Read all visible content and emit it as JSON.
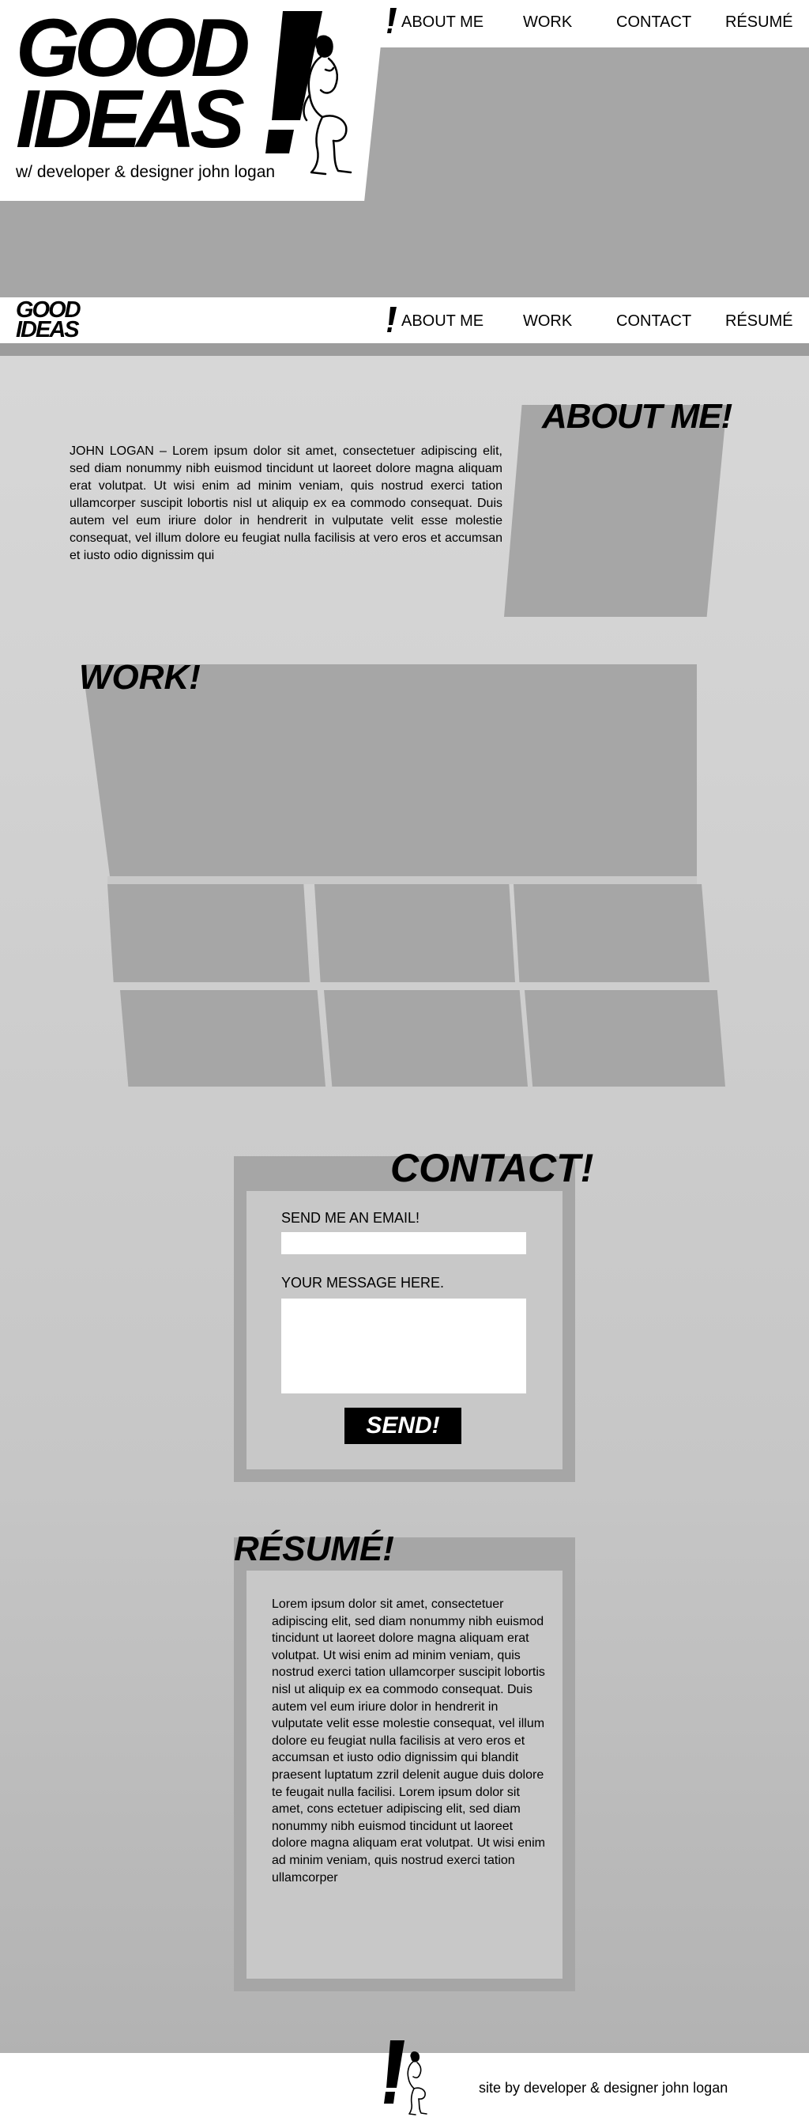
{
  "brand": {
    "logo_line1": "GOOD",
    "logo_line2": "IDEAS",
    "tagline": "w/ developer & designer john logan"
  },
  "nav": {
    "items": [
      "ABOUT ME",
      "WORK",
      "CONTACT",
      "RÉSUMÉ"
    ]
  },
  "about": {
    "heading": "ABOUT ME!",
    "body": "JOHN LOGAN – Lorem ipsum dolor sit amet, consectetuer adipiscing elit, sed diam nonummy nibh euismod tincidunt ut laoreet dolore magna aliquam erat volutpat. Ut wisi enim ad minim veniam, quis nostrud exerci tation ullamcorper suscipit lobortis nisl ut aliquip ex ea commodo consequat. Duis autem vel eum iriure dolor in hendrerit in vulputate velit esse molestie consequat, vel illum dolore eu feugiat nulla facilisis at vero eros et accumsan et iusto odio dignissim qui"
  },
  "work": {
    "heading": "WORK!"
  },
  "contact": {
    "heading": "CONTACT!",
    "email_label": "SEND ME AN EMAIL!",
    "email_value": "",
    "message_label": "YOUR MESSAGE HERE.",
    "message_value": "",
    "send_label": "SEND!"
  },
  "resume": {
    "heading": "RÉSUMÉ!",
    "body": "Lorem ipsum dolor sit amet, consectetuer adipiscing elit, sed diam nonummy nibh euismod tincidunt ut laoreet dolore magna aliquam erat volutpat. Ut wisi enim ad minim veniam, quis nostrud exerci tation ullamcorper suscipit lobortis nisl ut aliquip ex ea commodo consequat. Duis autem vel eum iriure dolor in hendrerit in vulputate velit esse molestie consequat, vel illum dolore eu feugiat nulla facilisis at vero eros et accumsan et iusto odio dignissim qui blandit praesent luptatum zzril delenit augue duis dolore te feugait nulla facilisi. Lorem ipsum dolor sit amet, cons ectetuer adipiscing elit, sed diam nonummy nibh euismod tincidunt ut laoreet dolore magna aliquam erat volutpat. Ut wisi enim ad minim veniam, quis nostrud exerci tation ullamcorper"
  },
  "footer": {
    "credit": "site by developer & designer john logan"
  },
  "icons": {
    "logo_mark": "exclamation-mark",
    "mascot": "thinker-statue"
  },
  "colors": {
    "placeholder_gray": "#a6a6a6",
    "panel_gray": "#c8c8c8",
    "button_black": "#000000",
    "white": "#ffffff"
  }
}
